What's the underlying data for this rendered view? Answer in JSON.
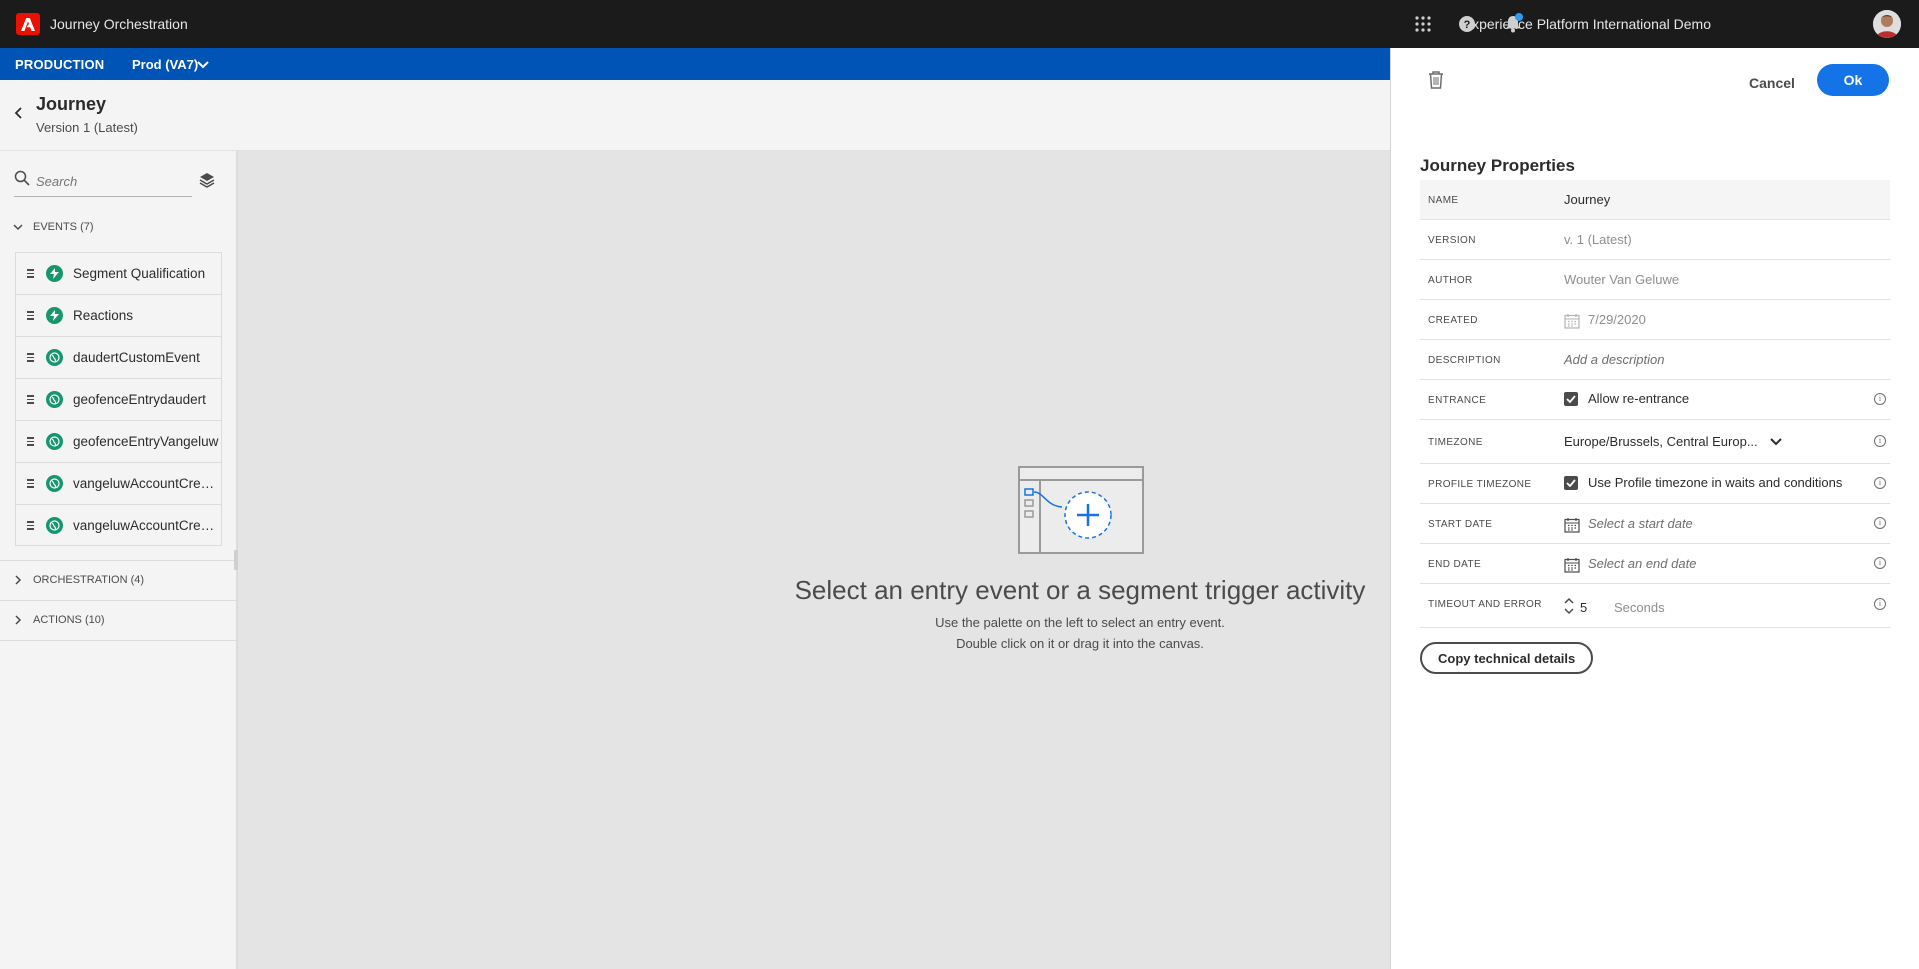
{
  "topbar": {
    "app_title": "Journey Orchestration",
    "org_name": "Experience Platform International Demo",
    "icons": [
      "apps-grid-icon",
      "help-icon",
      "bell-icon"
    ]
  },
  "envbar": {
    "environment": "PRODUCTION",
    "sandbox": "Prod (VA7)"
  },
  "journey": {
    "title": "Journey",
    "version": "Version 1 (Latest)"
  },
  "palette": {
    "search_placeholder": "Search",
    "events_header": "EVENTS (7)",
    "events": [
      {
        "label": "Segment Qualification",
        "icon": "bolt-icon"
      },
      {
        "label": "Reactions",
        "icon": "bolt-icon"
      },
      {
        "label": "daudertCustomEvent",
        "icon": "globe-icon"
      },
      {
        "label": "geofenceEntrydaudert",
        "icon": "globe-icon"
      },
      {
        "label": "geofenceEntryVangeluw",
        "icon": "globe-icon"
      },
      {
        "label": "vangeluwAccountCrea...",
        "icon": "globe-icon"
      },
      {
        "label": "vangeluwAccountCrea...",
        "icon": "globe-icon"
      }
    ],
    "orchestration_header": "ORCHESTRATION (4)",
    "actions_header": "ACTIONS (10)"
  },
  "canvas": {
    "empty_title": "Select an entry event or a segment trigger activity",
    "empty_line1": "Use the palette on the left to select an entry event.",
    "empty_line2": "Double click on it or drag it into the canvas."
  },
  "panel": {
    "cancel_label": "Cancel",
    "ok_label": "Ok",
    "title": "Journey Properties",
    "name_key": "NAME",
    "name_val": "Journey",
    "version_key": "VERSION",
    "version_val": "v. 1 (Latest)",
    "author_key": "AUTHOR",
    "author_val": "Wouter Van Geluwe",
    "created_key": "CREATED",
    "created_val": "7/29/2020",
    "description_key": "DESCRIPTION",
    "description_placeholder": "Add a description",
    "entrance_key": "ENTRANCE",
    "entrance_label": "Allow re-entrance",
    "entrance_checked": true,
    "timezone_key": "TIMEZONE",
    "timezone_val": "Europe/Brussels, Central Europ...",
    "profile_tz_key": "PROFILE TIMEZONE",
    "profile_tz_label": "Use Profile timezone in waits and conditions",
    "profile_tz_checked": true,
    "start_key": "START DATE",
    "start_placeholder": "Select a start date",
    "end_key": "END DATE",
    "end_placeholder": "Select an end date",
    "timeout_key": "TIMEOUT AND ERROR",
    "timeout_val": "5",
    "timeout_unit": "Seconds",
    "copy_label": "Copy technical details"
  },
  "colors": {
    "topbar": "#1b1b1b",
    "envbar": "#0054b6",
    "primary_button": "#1473e6",
    "event_icon": "#17966b",
    "adobe_red": "#eb1000"
  }
}
